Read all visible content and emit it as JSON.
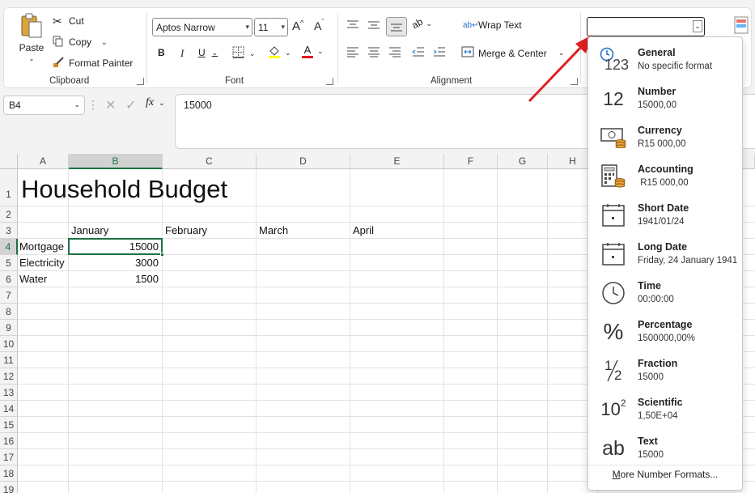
{
  "clipboard": {
    "paste_label": "Paste",
    "cut_label": "Cut",
    "copy_label": "Copy",
    "format_painter_label": "Format Painter",
    "group_label": "Clipboard"
  },
  "font": {
    "font_name": "Aptos Narrow",
    "font_size": "11",
    "group_label": "Font",
    "bold": "B",
    "italic": "I",
    "underline": "U",
    "grow": "A",
    "shrink": "A",
    "font_color_letter": "A",
    "font_color": "#e81123",
    "fill_color": "#ffff00"
  },
  "alignment": {
    "wrap_text_label": "Wrap Text",
    "merge_center_label": "Merge & Center",
    "group_label": "Alignment"
  },
  "formula_bar": {
    "name_box": "B4",
    "fx": "fx",
    "value": "15000"
  },
  "columns": [
    "A",
    "B",
    "C",
    "D",
    "E",
    "F",
    "G",
    "H"
  ],
  "rows": [
    "1",
    "2",
    "3",
    "4",
    "5",
    "6",
    "7",
    "8",
    "9",
    "10",
    "11",
    "12",
    "13",
    "14",
    "15",
    "16",
    "17",
    "18",
    "19"
  ],
  "sheet": {
    "title": "Household Budget",
    "months": [
      "January",
      "February",
      "March",
      "April"
    ],
    "items": [
      {
        "label": "Mortgage",
        "value": "15000"
      },
      {
        "label": "Electricity",
        "value": "3000"
      },
      {
        "label": "Water",
        "value": "1500"
      }
    ]
  },
  "number_format": {
    "current": "",
    "options": [
      {
        "title": "General",
        "sample": "No specific format",
        "icon": "clock-123-icon"
      },
      {
        "title": "Number",
        "sample": "15000,00",
        "icon": "number-12-icon"
      },
      {
        "title": "Currency",
        "sample": "R15 000,00",
        "icon": "currency-icon"
      },
      {
        "title": "Accounting",
        "sample": " R15 000,00",
        "icon": "accounting-icon"
      },
      {
        "title": "Short Date",
        "sample": "1941/01/24",
        "icon": "calendar-icon"
      },
      {
        "title": "Long Date",
        "sample": "Friday, 24 January 1941",
        "icon": "calendar-icon"
      },
      {
        "title": "Time",
        "sample": "00:00:00",
        "icon": "clock-icon"
      },
      {
        "title": "Percentage",
        "sample": "1500000,00%",
        "icon": "percent-icon"
      },
      {
        "title": "Fraction",
        "sample": "15000",
        "icon": "fraction-icon"
      },
      {
        "title": "Scientific",
        "sample": "1,50E+04",
        "icon": "scientific-icon"
      },
      {
        "title": "Text",
        "sample": "15000",
        "icon": "text-ab-icon"
      }
    ],
    "icon_glyphs": {
      "number": "12",
      "percent": "%",
      "fraction_top": "1",
      "fraction_bottom": "2",
      "sci_base": "10",
      "sci_exp": "2",
      "text": "ab",
      "general": "123"
    },
    "more_label_first": "M",
    "more_label_rest": "ore Number Formats..."
  },
  "accent": {
    "selection": "#1e7145",
    "arrow": "#e02020"
  }
}
